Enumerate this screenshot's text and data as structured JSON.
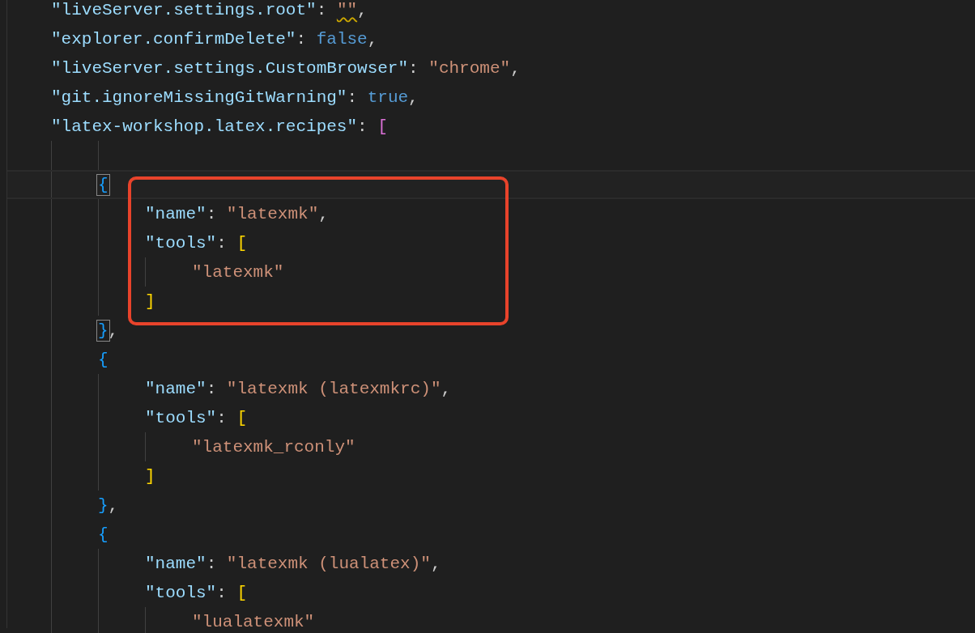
{
  "editor": {
    "lines": [
      {
        "kind": "code",
        "tokens": [
          {
            "kind": "key",
            "text": "\"liveServer.settings.root\""
          },
          {
            "kind": "punct",
            "text": ": "
          },
          {
            "kind": "str",
            "text": "\"\"",
            "warning": true
          },
          {
            "kind": "punct",
            "text": ","
          }
        ]
      },
      {
        "kind": "code",
        "tokens": [
          {
            "kind": "key",
            "text": "\"explorer.confirmDelete\""
          },
          {
            "kind": "punct",
            "text": ": "
          },
          {
            "kind": "kw",
            "text": "false"
          },
          {
            "kind": "punct",
            "text": ","
          }
        ]
      },
      {
        "kind": "code",
        "tokens": [
          {
            "kind": "key",
            "text": "\"liveServer.settings.CustomBrowser\""
          },
          {
            "kind": "punct",
            "text": ": "
          },
          {
            "kind": "str",
            "text": "\"chrome\""
          },
          {
            "kind": "punct",
            "text": ","
          }
        ]
      },
      {
        "kind": "code",
        "tokens": [
          {
            "kind": "key",
            "text": "\"git.ignoreMissingGitWarning\""
          },
          {
            "kind": "punct",
            "text": ": "
          },
          {
            "kind": "kw",
            "text": "true"
          },
          {
            "kind": "punct",
            "text": ","
          }
        ]
      },
      {
        "kind": "code",
        "tokens": [
          {
            "kind": "key",
            "text": "\"latex-workshop.latex.recipes\""
          },
          {
            "kind": "punct",
            "text": ": "
          },
          {
            "kind": "bracket1",
            "text": "["
          }
        ],
        "children": [
          {
            "kind": "blank"
          },
          {
            "kind": "code",
            "current": true,
            "tokens": [
              {
                "kind": "bracket2",
                "text": "{",
                "matched": true
              }
            ],
            "children": [
              {
                "kind": "code",
                "boxed": true,
                "tokens": [
                  {
                    "kind": "key",
                    "text": "\"name\""
                  },
                  {
                    "kind": "punct",
                    "text": ": "
                  },
                  {
                    "kind": "str",
                    "text": "\"latexmk\""
                  },
                  {
                    "kind": "punct",
                    "text": ","
                  }
                ]
              },
              {
                "kind": "code",
                "boxed": true,
                "tokens": [
                  {
                    "kind": "key",
                    "text": "\"tools\""
                  },
                  {
                    "kind": "punct",
                    "text": ": "
                  },
                  {
                    "kind": "bracket3",
                    "text": "["
                  }
                ],
                "children": [
                  {
                    "kind": "code",
                    "boxed": true,
                    "tokens": [
                      {
                        "kind": "str",
                        "text": "\"latexmk\""
                      }
                    ]
                  }
                ]
              },
              {
                "kind": "code",
                "boxed": true,
                "tokens": [
                  {
                    "kind": "bracket3",
                    "text": "]"
                  }
                ]
              }
            ]
          },
          {
            "kind": "code",
            "tokens": [
              {
                "kind": "bracket2",
                "text": "}",
                "matched": true
              },
              {
                "kind": "punct",
                "text": ","
              }
            ]
          },
          {
            "kind": "code",
            "tokens": [
              {
                "kind": "bracket2",
                "text": "{"
              }
            ],
            "children": [
              {
                "kind": "code",
                "tokens": [
                  {
                    "kind": "key",
                    "text": "\"name\""
                  },
                  {
                    "kind": "punct",
                    "text": ": "
                  },
                  {
                    "kind": "str",
                    "text": "\"latexmk (latexmkrc)\""
                  },
                  {
                    "kind": "punct",
                    "text": ","
                  }
                ]
              },
              {
                "kind": "code",
                "tokens": [
                  {
                    "kind": "key",
                    "text": "\"tools\""
                  },
                  {
                    "kind": "punct",
                    "text": ": "
                  },
                  {
                    "kind": "bracket3",
                    "text": "["
                  }
                ],
                "children": [
                  {
                    "kind": "code",
                    "tokens": [
                      {
                        "kind": "str",
                        "text": "\"latexmk_rconly\""
                      }
                    ]
                  }
                ]
              },
              {
                "kind": "code",
                "tokens": [
                  {
                    "kind": "bracket3",
                    "text": "]"
                  }
                ]
              }
            ]
          },
          {
            "kind": "code",
            "tokens": [
              {
                "kind": "bracket2",
                "text": "}"
              },
              {
                "kind": "punct",
                "text": ","
              }
            ]
          },
          {
            "kind": "code",
            "tokens": [
              {
                "kind": "bracket2",
                "text": "{"
              }
            ],
            "children": [
              {
                "kind": "code",
                "tokens": [
                  {
                    "kind": "key",
                    "text": "\"name\""
                  },
                  {
                    "kind": "punct",
                    "text": ": "
                  },
                  {
                    "kind": "str",
                    "text": "\"latexmk (lualatex)\""
                  },
                  {
                    "kind": "punct",
                    "text": ","
                  }
                ]
              },
              {
                "kind": "code",
                "tokens": [
                  {
                    "kind": "key",
                    "text": "\"tools\""
                  },
                  {
                    "kind": "punct",
                    "text": ": "
                  },
                  {
                    "kind": "bracket3",
                    "text": "["
                  }
                ],
                "children": [
                  {
                    "kind": "code",
                    "tokens": [
                      {
                        "kind": "str",
                        "text": "\"lualatexmk\""
                      }
                    ]
                  }
                ]
              }
            ]
          }
        ]
      }
    ]
  }
}
